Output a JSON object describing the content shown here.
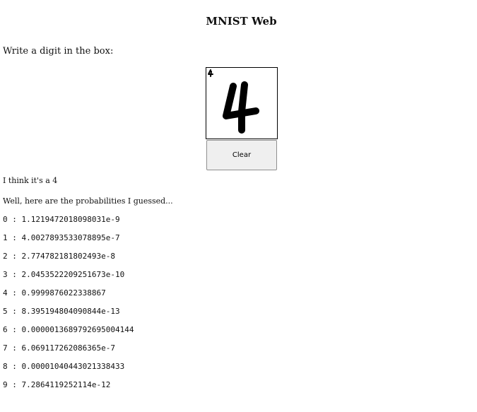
{
  "page": {
    "title": "MNIST Web",
    "instruction": "Write a digit in the box:",
    "clear_label": "Clear",
    "guess_text": "I think it's a 4",
    "probabilities_heading": "Well, here are the probabilities I guessed..."
  },
  "canvas": {
    "small_preview_digit": "4",
    "drawn_digit": "4"
  },
  "probabilities": [
    {
      "digit": "0",
      "value": "1.1219472018098031e-9"
    },
    {
      "digit": "1",
      "value": "4.0027893533078895e-7"
    },
    {
      "digit": "2",
      "value": "2.774782181802493e-8"
    },
    {
      "digit": "3",
      "value": "2.0453522209251673e-10"
    },
    {
      "digit": "4",
      "value": "0.9999876022338867"
    },
    {
      "digit": "5",
      "value": "8.395194804090844e-13"
    },
    {
      "digit": "6",
      "value": "0.0000013689792695004144"
    },
    {
      "digit": "7",
      "value": "6.069117262086365e-7"
    },
    {
      "digit": "8",
      "value": "0.00001040443021338433"
    },
    {
      "digit": "9",
      "value": "7.2864119252114e-12"
    }
  ]
}
